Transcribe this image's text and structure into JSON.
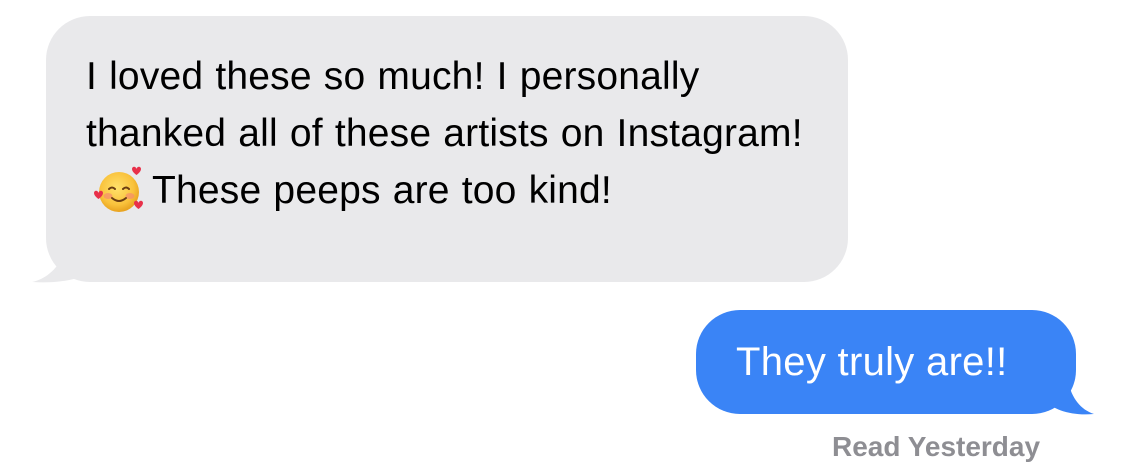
{
  "conversation": {
    "messages": [
      {
        "direction": "incoming",
        "text_before_emoji": "I loved these so much! I personally thanked all of these artists on Instagram!",
        "emoji": "smiling-face-with-hearts-icon",
        "text_after_emoji": "These peeps are too kind!"
      },
      {
        "direction": "outgoing",
        "text": "They truly are!!"
      }
    ],
    "read_receipt": "Read Yesterday"
  },
  "colors": {
    "incoming_bubble": "#e9e9eb",
    "outgoing_bubble": "#3a84f6",
    "incoming_text": "#000000",
    "outgoing_text": "#ffffff",
    "receipt_text": "#8e8e93"
  }
}
